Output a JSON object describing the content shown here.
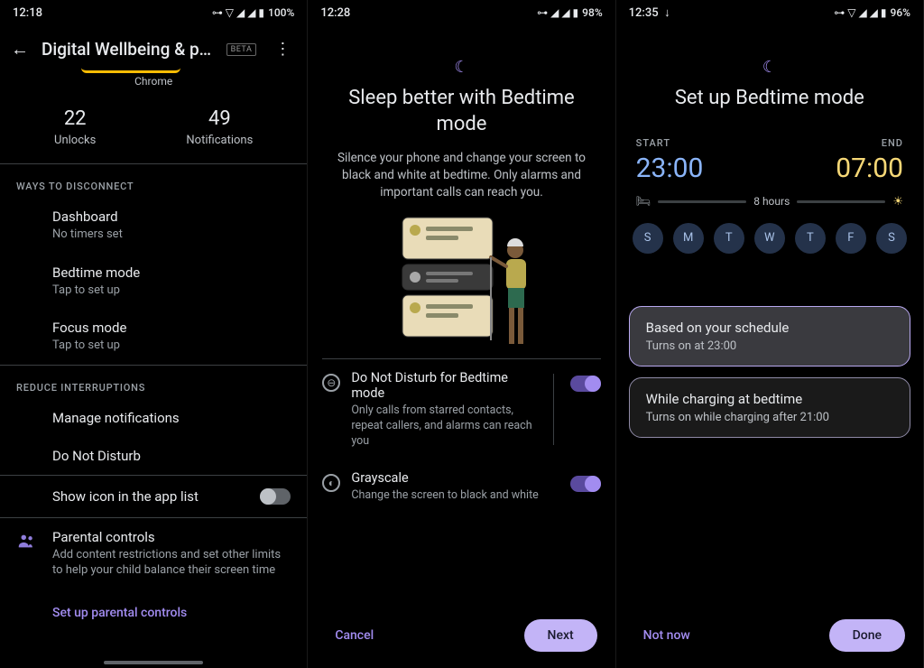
{
  "panel1": {
    "status": {
      "time": "12:18",
      "battery": "100%",
      "icons": "⊶ ▽ ◢ ◢ ▮"
    },
    "header": {
      "title": "Digital Wellbeing & pa…",
      "badge": "BETA"
    },
    "chrome_label": "Chrome",
    "stats": {
      "unlocks_n": "22",
      "unlocks_l": "Unlocks",
      "notifs_n": "49",
      "notifs_l": "Notifications"
    },
    "sections": {
      "ways": "WAYS TO DISCONNECT",
      "reduce": "REDUCE INTERRUPTIONS"
    },
    "items": {
      "dashboard": {
        "title": "Dashboard",
        "sub": "No timers set"
      },
      "bedtime": {
        "title": "Bedtime mode",
        "sub": "Tap to set up"
      },
      "focus": {
        "title": "Focus mode",
        "sub": "Tap to set up"
      },
      "manage": {
        "title": "Manage notifications"
      },
      "dnd": {
        "title": "Do Not Disturb"
      },
      "showicon": {
        "title": "Show icon in the app list"
      },
      "parental": {
        "title": "Parental controls",
        "sub": "Add content restrictions and set other limits to help your child balance their screen time",
        "link": "Set up parental controls"
      }
    }
  },
  "panel2": {
    "status": {
      "time": "12:28",
      "battery": "98%",
      "icons": "⊶ ◢ ◢ ▮"
    },
    "title": "Sleep better with Bedtime mode",
    "desc": "Silence your phone and change your screen to black and white at bedtime. Only alarms and important calls can reach you.",
    "dnd": {
      "title": "Do Not Disturb for Bedtime mode",
      "sub": "Only calls from starred contacts, repeat callers, and alarms can reach you"
    },
    "gray": {
      "title": "Grayscale",
      "sub": "Change the screen to black and white"
    },
    "cancel": "Cancel",
    "next": "Next"
  },
  "panel3": {
    "status": {
      "time": "12:35",
      "battery": "96%",
      "icons": "⊶ ▽ ◢ ◢ ▮"
    },
    "title": "Set up Bedtime mode",
    "start_l": "START",
    "start_v": "23:00",
    "end_l": "END",
    "end_v": "07:00",
    "duration": "8 hours",
    "days": [
      "S",
      "M",
      "T",
      "W",
      "T",
      "F",
      "S"
    ],
    "card1": {
      "title": "Based on your schedule",
      "sub": "Turns on at 23:00"
    },
    "card2": {
      "title": "While charging at bedtime",
      "sub": "Turns on while charging after 21:00"
    },
    "notnow": "Not now",
    "done": "Done"
  }
}
